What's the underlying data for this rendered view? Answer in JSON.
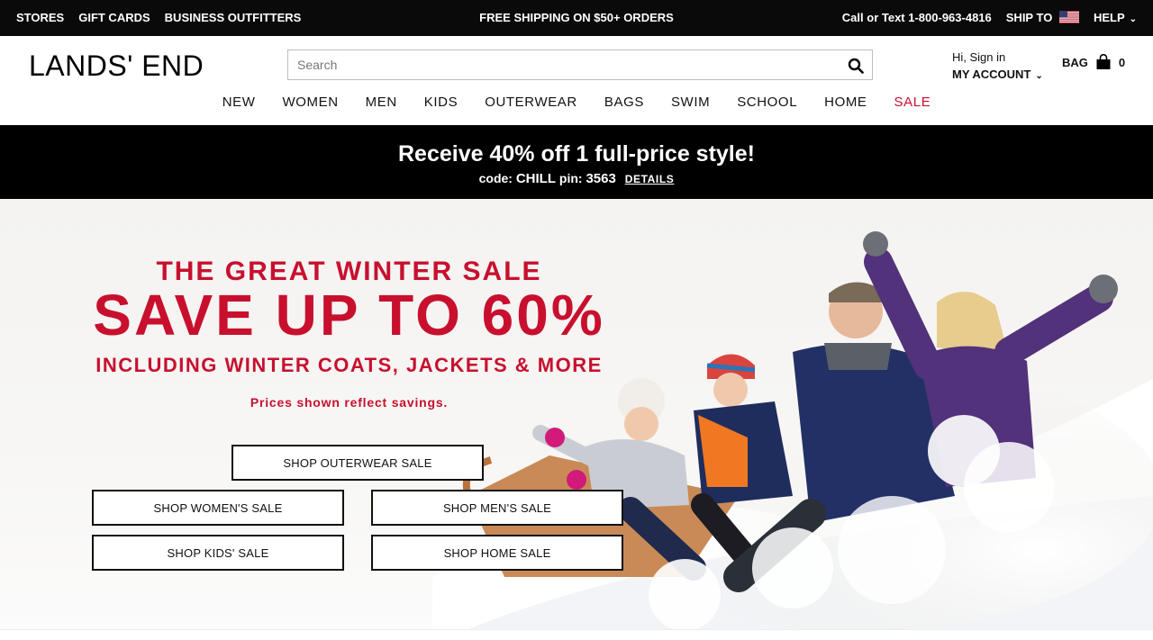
{
  "topbar": {
    "left_links": [
      "STORES",
      "GIFT CARDS",
      "BUSINESS OUTFITTERS"
    ],
    "center": "FREE SHIPPING ON $50+ ORDERS",
    "phone": "Call or Text 1-800-963-4816",
    "ship_to": "SHIP TO",
    "help": "HELP"
  },
  "header": {
    "logo": "LANDS' END",
    "search_placeholder": "Search",
    "account_greeting": "Hi, Sign in",
    "account_label": "MY ACCOUNT",
    "bag_label": "BAG",
    "bag_count": "0"
  },
  "nav": {
    "items": [
      "NEW",
      "WOMEN",
      "MEN",
      "KIDS",
      "OUTERWEAR",
      "BAGS",
      "SWIM",
      "SCHOOL",
      "HOME",
      "SALE"
    ]
  },
  "promo": {
    "headline": "Receive 40% off 1 full-price style!",
    "code_label": "code:",
    "code_value": "CHILL",
    "pin_label": "pin:",
    "pin_value": "3563",
    "details": "DETAILS"
  },
  "hero": {
    "eyebrow": "THE GREAT WINTER SALE",
    "headline": "SAVE UP TO 60%",
    "subhead": "INCLUDING WINTER COATS, JACKETS & MORE",
    "note": "Prices shown reflect savings.",
    "buttons": {
      "outerwear": "SHOP OUTERWEAR SALE",
      "women": "SHOP WOMEN'S SALE",
      "men": "SHOP MEN'S SALE",
      "kids": "SHOP KIDS' SALE",
      "home": "SHOP HOME SALE"
    }
  },
  "colors": {
    "brand_red": "#c8102e",
    "black": "#000000"
  }
}
